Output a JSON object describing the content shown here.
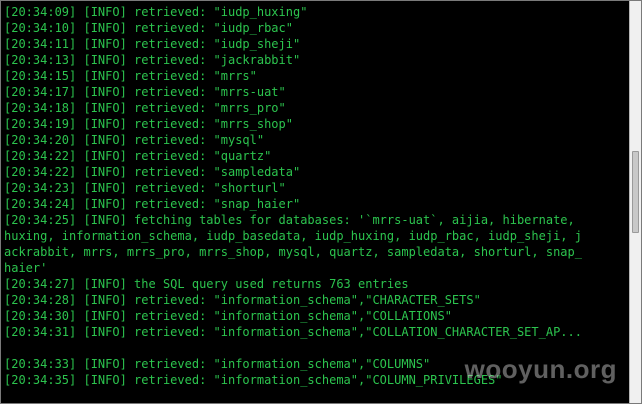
{
  "terminal": {
    "lines": [
      "[20:34:09] [INFO] retrieved: \"iudp_huxing\"",
      "[20:34:10] [INFO] retrieved: \"iudp_rbac\"",
      "[20:34:11] [INFO] retrieved: \"iudp_sheji\"",
      "[20:34:13] [INFO] retrieved: \"jackrabbit\"",
      "[20:34:15] [INFO] retrieved: \"mrrs\"",
      "[20:34:17] [INFO] retrieved: \"mrrs-uat\"",
      "[20:34:18] [INFO] retrieved: \"mrrs_pro\"",
      "[20:34:19] [INFO] retrieved: \"mrrs_shop\"",
      "[20:34:20] [INFO] retrieved: \"mysql\"",
      "[20:34:22] [INFO] retrieved: \"quartz\"",
      "[20:34:22] [INFO] retrieved: \"sampledata\"",
      "[20:34:23] [INFO] retrieved: \"shorturl\"",
      "[20:34:24] [INFO] retrieved: \"snap_haier\"",
      "[20:34:25] [INFO] fetching tables for databases: '`mrrs-uat`, aijia, hibernate, ",
      "huxing, information_schema, iudp_basedata, iudp_huxing, iudp_rbac, iudp_sheji, j",
      "ackrabbit, mrrs, mrrs_pro, mrrs_shop, mysql, quartz, sampledata, shorturl, snap_",
      "haier'",
      "[20:34:27] [INFO] the SQL query used returns 763 entries",
      "[20:34:28] [INFO] retrieved: \"information_schema\",\"CHARACTER_SETS\"",
      "[20:34:30] [INFO] retrieved: \"information_schema\",\"COLLATIONS\"",
      "[20:34:31] [INFO] retrieved: \"information_schema\",\"COLLATION_CHARACTER_SET_AP...",
      "",
      "[20:34:33] [INFO] retrieved: \"information_schema\",\"COLUMNS\"",
      "[20:34:35] [INFO] retrieved: \"information_schema\",\"COLUMN_PRIVILEGES\""
    ]
  },
  "watermark": {
    "text": "wooyun.org"
  },
  "colors": {
    "background": "#000000",
    "text": "#2cc44e",
    "scrollbar": "#f0f0f0"
  }
}
